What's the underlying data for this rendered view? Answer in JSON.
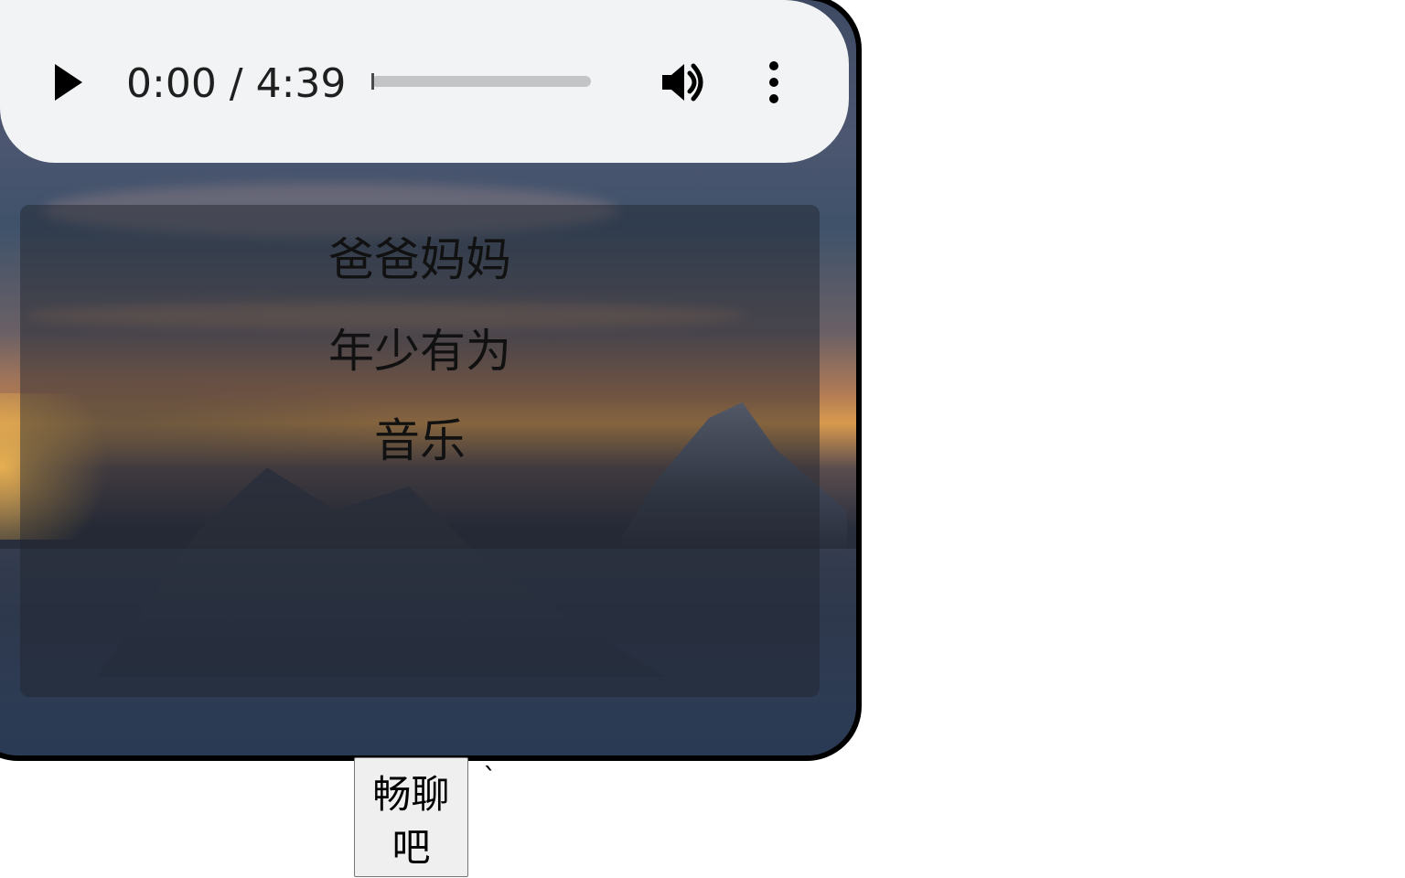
{
  "audio_player": {
    "time_display": "0:00 / 4:39",
    "progress": 0,
    "icons": {
      "play": "play-icon",
      "volume": "volume-icon",
      "menu": "more-vertical-icon"
    }
  },
  "nav": {
    "items": [
      {
        "label": "爸爸妈妈"
      },
      {
        "label": "年少有为"
      },
      {
        "label": "音乐"
      }
    ]
  },
  "chat_button": {
    "label": "畅聊吧"
  },
  "stray_text": "`",
  "colors": {
    "player_bg": "#f1f3f4",
    "card_border": "#000000",
    "text": "#111111"
  }
}
